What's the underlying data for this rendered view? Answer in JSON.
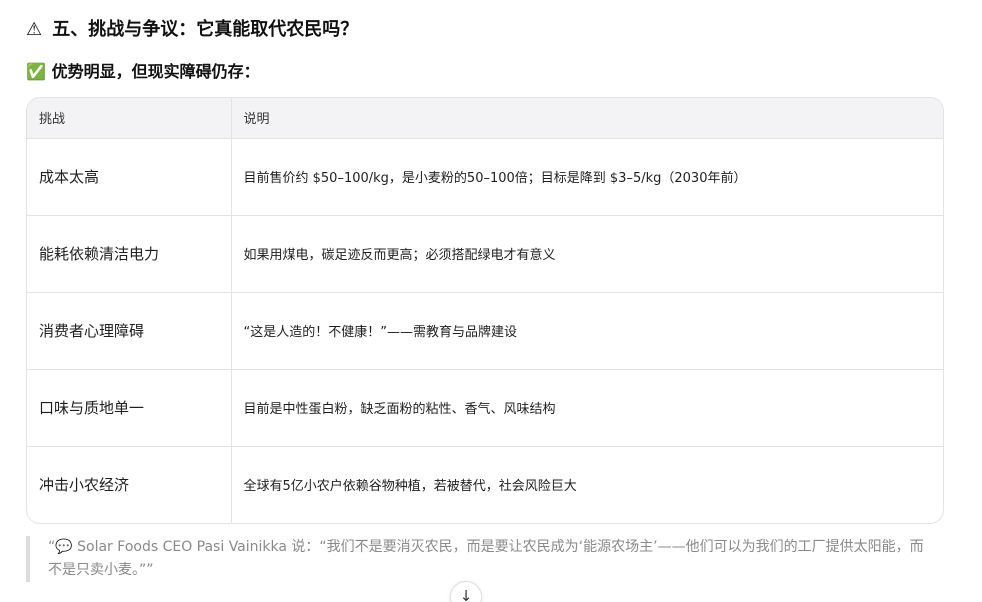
{
  "section": {
    "icon": "⚠",
    "icon_name": "warning-icon",
    "title": "五、挑战与争议：它真能取代农民吗？"
  },
  "subsection": {
    "icon": "✅",
    "icon_name": "check-icon",
    "title": "优势明显，但现实障碍仍存："
  },
  "table": {
    "headers": [
      "挑战",
      "说明"
    ],
    "rows": [
      {
        "challenge": "成本太高",
        "description": "目前售价约 $50–100/kg，是小麦粉的50–100倍；目标是降到 $3–5/kg（2030年前）"
      },
      {
        "challenge": "能耗依赖清洁电力",
        "description": "如果用煤电，碳足迹反而更高；必须搭配绿电才有意义"
      },
      {
        "challenge": "消费者心理障碍",
        "description": "“这是人造的！不健康！”——需教育与品牌建设"
      },
      {
        "challenge": "口味与质地单一",
        "description": "目前是中性蛋白粉，缺乏面粉的粘性、香气、风味结构"
      },
      {
        "challenge": "冲击小农经济",
        "description": "全球有5亿小农户依赖谷物种植，若被替代，社会风险巨大"
      }
    ]
  },
  "quote": {
    "text": "“💬 Solar Foods CEO Pasi Vainikka 说：“我们不是要消灭农民，而是要让农民成为‘能源农场主’——他们可以为我们的工厂提供太阳能，而不是只卖小麦。””"
  },
  "scroll_button": {
    "icon": "↓",
    "icon_name": "arrow-down-icon"
  }
}
